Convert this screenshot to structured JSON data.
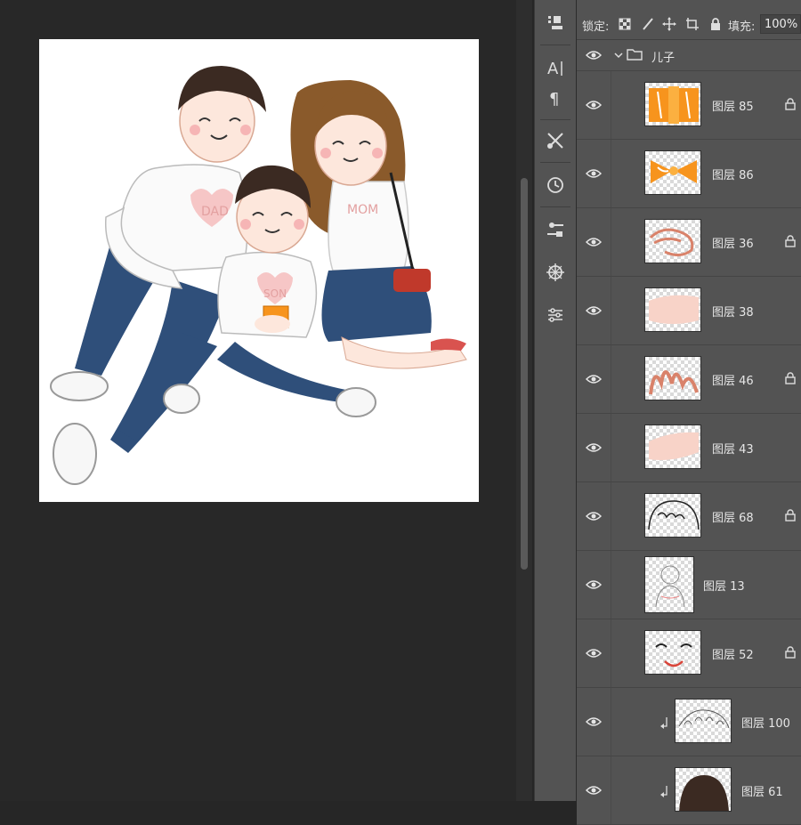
{
  "lock_bar": {
    "lock_label": "锁定:",
    "fill_label": "填充:",
    "fill_value": "100%"
  },
  "group": {
    "name": "儿子"
  },
  "layers": [
    {
      "name": "图层 85",
      "locked": true
    },
    {
      "name": "图层 86",
      "locked": false
    },
    {
      "name": "图层 36",
      "locked": true
    },
    {
      "name": "图层 38",
      "locked": false
    },
    {
      "name": "图层 46",
      "locked": true
    },
    {
      "name": "图层 43",
      "locked": false
    },
    {
      "name": "图层 68",
      "locked": true
    },
    {
      "name": "图层 13",
      "locked": false
    },
    {
      "name": "图层 52",
      "locked": true
    },
    {
      "name": "图层 100",
      "locked": false,
      "clipped": true
    },
    {
      "name": "图层 61",
      "locked": false,
      "clipped": true
    }
  ],
  "artwork": {
    "dad_shirt": "DAD",
    "son_shirt": "SON",
    "mom_shirt": "MOM"
  },
  "colors": {
    "panel_bg": "#535353",
    "canvas_bg": "#282828",
    "jeans": "#2f4f7a",
    "hair_dark": "#3b2a22",
    "hair_brown": "#8a5a2b",
    "gift_orange": "#f7941d",
    "bag_red": "#c0392b"
  }
}
